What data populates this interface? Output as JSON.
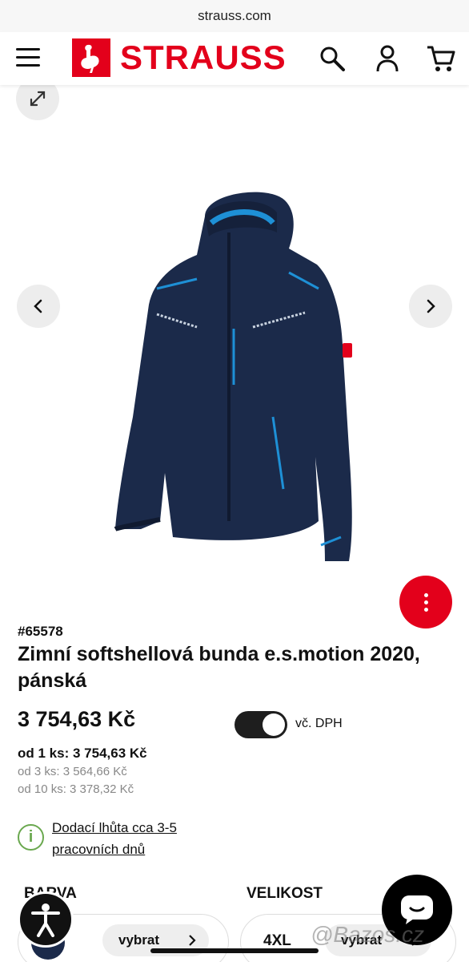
{
  "browser": {
    "url": "strauss.com"
  },
  "header": {
    "brand": "STRAUSS"
  },
  "product": {
    "sku": "#65578",
    "title": "Zimní softshellová bunda e.s.motion 2020, pánská",
    "price": "3 754,63 Kč",
    "vat_toggle_label": "vč. DPH",
    "vat_toggle_on": true,
    "tiers": [
      {
        "label": "od 1 ks:",
        "price": "3 754,63 Kč"
      },
      {
        "label": "od 3 ks:",
        "price": "3 564,66 Kč"
      },
      {
        "label": "od 10 ks:",
        "price": "3 378,32 Kč"
      }
    ],
    "delivery": "Dodací lhůta cca 3-5 pracovních dnů"
  },
  "options": {
    "color_label": "BARVA",
    "size_label": "VELIKOST",
    "color_select": "vybrat",
    "size_value": "4XL",
    "size_select": "vybrat"
  },
  "watermark": "@Bazos.cz",
  "colors": {
    "brand_red": "#e3001b",
    "jacket_navy": "#1b2a4a",
    "accent_blue": "#1e90d6",
    "info_green": "#6aa84f"
  },
  "icons": [
    "menu-icon",
    "search-icon",
    "user-icon",
    "cart-icon",
    "expand-icon",
    "chevron-left-icon",
    "chevron-right-icon",
    "more-vertical-icon",
    "info-icon",
    "accessibility-icon",
    "chat-icon"
  ]
}
